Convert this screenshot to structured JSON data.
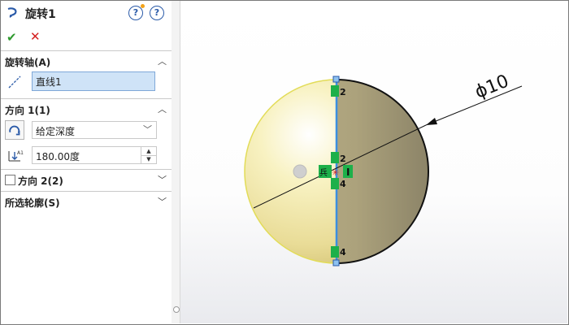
{
  "feature": {
    "title": "旋转1",
    "help_label": "?",
    "help2_label": "?"
  },
  "actions": {
    "ok_label": "✔",
    "cancel_label": "✕"
  },
  "axis_section": {
    "title": "旋转轴(A)",
    "value": "直线1"
  },
  "direction1": {
    "title": "方向 1(1)",
    "end_condition": "给定深度",
    "angle": "180.00度"
  },
  "direction2": {
    "title": "方向 2(2)"
  },
  "contours": {
    "title": "所选轮廓(S)"
  },
  "sketch": {
    "dimension_label": "ϕ10",
    "constraint_labels": {
      "top": "2",
      "mid": "2",
      "lower": "4",
      "bottom": "4",
      "vertical": "I",
      "origin": "兵"
    }
  },
  "colors": {
    "accent_blue": "#2a5aa8",
    "ok_green": "#2e9a2e",
    "cancel_red": "#d42020",
    "selection_bg": "#cfe3f7",
    "relation_green": "#1db04a",
    "axis_line": "#3b8fe0"
  }
}
